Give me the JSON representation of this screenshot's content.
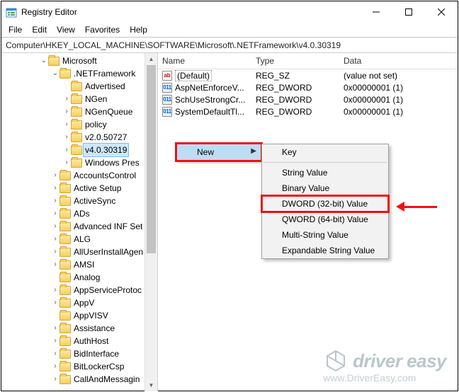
{
  "titlebar": {
    "title": "Registry Editor"
  },
  "menu": {
    "file": "File",
    "edit": "Edit",
    "view": "View",
    "favorites": "Favorites",
    "help": "Help"
  },
  "address": {
    "path": "Computer\\HKEY_LOCAL_MACHINE\\SOFTWARE\\Microsoft\\.NETFramework\\v4.0.30319"
  },
  "tree": {
    "root_label": "Microsoft",
    "net_label": ".NETFramework",
    "children": [
      {
        "label": "Advertised",
        "tw": ""
      },
      {
        "label": "NGen",
        "tw": "›"
      },
      {
        "label": "NGenQueue",
        "tw": "›"
      },
      {
        "label": "policy",
        "tw": "›"
      },
      {
        "label": "v2.0.50727",
        "tw": "›"
      },
      {
        "label": "v4.0.30319",
        "tw": "›",
        "sel": true
      },
      {
        "label": "Windows Pres",
        "tw": "›"
      }
    ],
    "siblings": [
      {
        "label": "AccountsControl",
        "tw": "›"
      },
      {
        "label": "Active Setup",
        "tw": "›"
      },
      {
        "label": "ActiveSync",
        "tw": "›"
      },
      {
        "label": "ADs",
        "tw": "›"
      },
      {
        "label": "Advanced INF Set",
        "tw": "›"
      },
      {
        "label": "ALG",
        "tw": "›"
      },
      {
        "label": "AllUserInstallAgen",
        "tw": "›"
      },
      {
        "label": "AMSI",
        "tw": "›"
      },
      {
        "label": "Analog",
        "tw": ""
      },
      {
        "label": "AppServiceProtoc",
        "tw": "›"
      },
      {
        "label": "AppV",
        "tw": "›"
      },
      {
        "label": "AppVISV",
        "tw": ""
      },
      {
        "label": "Assistance",
        "tw": "›"
      },
      {
        "label": "AuthHost",
        "tw": "›"
      },
      {
        "label": "BidInterface",
        "tw": "›"
      },
      {
        "label": "BitLockerCsp",
        "tw": "›"
      },
      {
        "label": "CallAndMessagin",
        "tw": "›"
      }
    ]
  },
  "list": {
    "headers": {
      "name": "Name",
      "type": "Type",
      "data": "Data"
    },
    "rows": [
      {
        "icon": "ab",
        "name": "(Default)",
        "type": "REG_SZ",
        "data": "(value not set)",
        "default": true
      },
      {
        "icon": "bin",
        "name": "AspNetEnforceV...",
        "type": "REG_DWORD",
        "data": "0x00000001 (1)"
      },
      {
        "icon": "bin",
        "name": "SchUseStrongCr...",
        "type": "REG_DWORD",
        "data": "0x00000001 (1)"
      },
      {
        "icon": "bin",
        "name": "SystemDefaultTl...",
        "type": "REG_DWORD",
        "data": "0x00000001 (1)"
      }
    ]
  },
  "ctx1": {
    "new": "New"
  },
  "ctx2": {
    "key": "Key",
    "string": "String Value",
    "binary": "Binary Value",
    "dword": "DWORD (32-bit) Value",
    "qword": "QWORD (64-bit) Value",
    "multi": "Multi-String Value",
    "exp": "Expandable String Value"
  },
  "watermark": {
    "brand": "driver easy",
    "url": "www.DriverEasy.com"
  }
}
